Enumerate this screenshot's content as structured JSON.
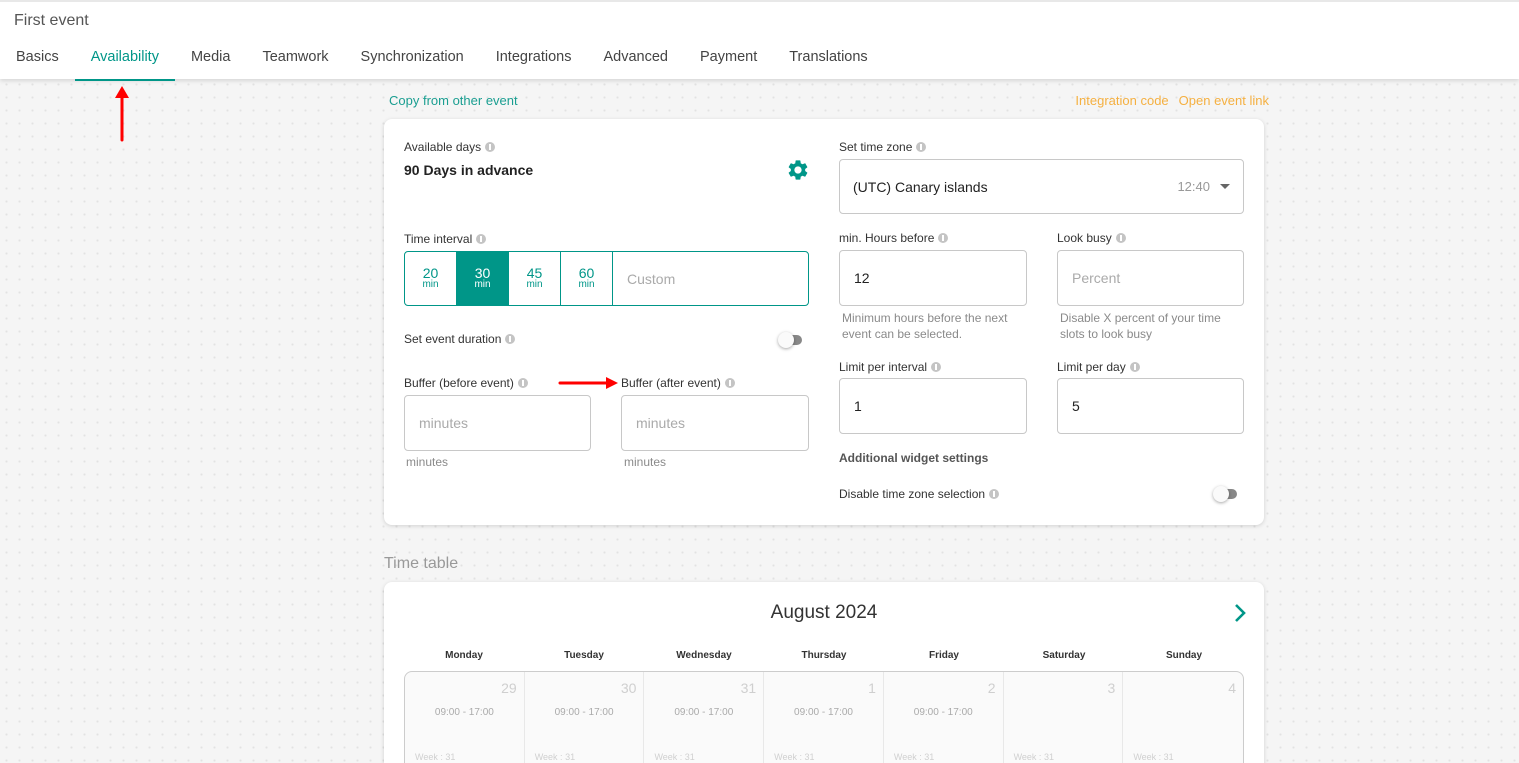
{
  "header": {
    "title": "First event",
    "tabs": [
      {
        "label": "Basics",
        "active": false
      },
      {
        "label": "Availability",
        "active": true
      },
      {
        "label": "Media",
        "active": false
      },
      {
        "label": "Teamwork",
        "active": false
      },
      {
        "label": "Synchronization",
        "active": false
      },
      {
        "label": "Integrations",
        "active": false
      },
      {
        "label": "Advanced",
        "active": false
      },
      {
        "label": "Payment",
        "active": false
      },
      {
        "label": "Translations",
        "active": false
      }
    ]
  },
  "links": {
    "copy": "Copy from other event",
    "integration_code": "Integration code",
    "open_event_link": "Open event link"
  },
  "settings": {
    "available_days": {
      "label": "Available days",
      "value": "90 Days in advance"
    },
    "time_interval": {
      "label": "Time interval",
      "options": [
        {
          "value": "20",
          "unit": "min",
          "selected": false
        },
        {
          "value": "30",
          "unit": "min",
          "selected": true
        },
        {
          "value": "45",
          "unit": "min",
          "selected": false
        },
        {
          "value": "60",
          "unit": "min",
          "selected": false
        }
      ],
      "custom_placeholder": "Custom"
    },
    "event_duration": {
      "label": "Set event duration",
      "enabled": false
    },
    "buffer_before": {
      "label": "Buffer (before event)",
      "placeholder": "minutes",
      "value": "",
      "hint": "minutes"
    },
    "buffer_after": {
      "label": "Buffer (after event)",
      "placeholder": "minutes",
      "value": "",
      "hint": "minutes"
    },
    "time_zone": {
      "label": "Set time zone",
      "value": "(UTC) Canary islands",
      "time": "12:40"
    },
    "min_hours_before": {
      "label": "min. Hours before",
      "value": "12",
      "hint": "Minimum hours before the next event can be selected."
    },
    "look_busy": {
      "label": "Look busy",
      "placeholder": "Percent",
      "value": "",
      "hint": "Disable X percent of your time slots to look busy"
    },
    "limit_per_interval": {
      "label": "Limit per interval",
      "value": "1"
    },
    "limit_per_day": {
      "label": "Limit per day",
      "value": "5"
    },
    "additional_heading": "Additional widget settings",
    "disable_tz_selection": {
      "label": "Disable time zone selection",
      "enabled": false
    }
  },
  "timetable": {
    "title": "Time table",
    "month": "August 2024",
    "weekdays": [
      "Monday",
      "Tuesday",
      "Wednesday",
      "Thursday",
      "Friday",
      "Saturday",
      "Sunday"
    ],
    "days": [
      {
        "num": "29",
        "hours": "09:00 - 17:00",
        "week": "Week : 31"
      },
      {
        "num": "30",
        "hours": "09:00 - 17:00",
        "week": "Week : 31"
      },
      {
        "num": "31",
        "hours": "09:00 - 17:00",
        "week": "Week : 31"
      },
      {
        "num": "1",
        "hours": "09:00 - 17:00",
        "week": "Week : 31"
      },
      {
        "num": "2",
        "hours": "09:00 - 17:00",
        "week": "Week : 31"
      },
      {
        "num": "3",
        "hours": "",
        "week": "Week : 31"
      },
      {
        "num": "4",
        "hours": "",
        "week": "Week : 31"
      }
    ]
  },
  "colors": {
    "accent": "#009688",
    "link_orange": "#f5b041",
    "annotation_red": "#ff0000"
  }
}
